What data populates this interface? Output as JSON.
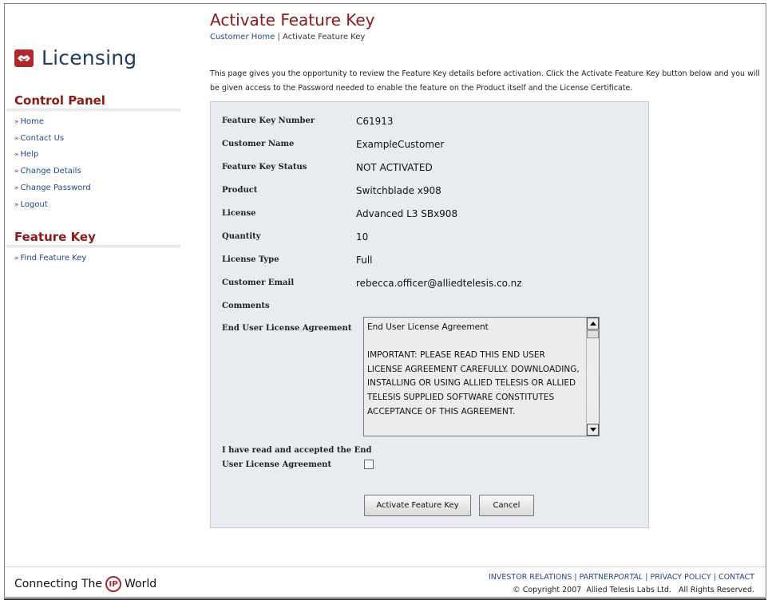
{
  "sidebar": {
    "app_title": "Licensing",
    "control_panel": {
      "title": "Control Panel",
      "items": [
        {
          "label": "Home"
        },
        {
          "label": "Contact Us"
        },
        {
          "label": "Help"
        },
        {
          "label": "Change Details"
        },
        {
          "label": "Change Password"
        },
        {
          "label": "Logout"
        }
      ]
    },
    "feature_key": {
      "title": "Feature Key",
      "items": [
        {
          "label": "Find Feature Key"
        }
      ]
    },
    "arrow": "»"
  },
  "header": {
    "title": "Activate Feature Key",
    "breadcrumb": {
      "home": "Customer Home",
      "separator": " | ",
      "current": "Activate Feature Key"
    }
  },
  "intro": "This page gives you the opportunity to review the Feature Key details before activation. Click the Activate Feature Key button below and you will be given access to the Password needed to enable the feature on the Product itself and the License Certificate.",
  "details": {
    "feature_key_number": {
      "label": "Feature Key Number",
      "value": "C61913"
    },
    "customer_name": {
      "label": "Customer Name",
      "value": "ExampleCustomer"
    },
    "status": {
      "label": "Feature Key Status",
      "value": "NOT ACTIVATED"
    },
    "product": {
      "label": "Product",
      "value": "Switchblade x908"
    },
    "license": {
      "label": "License",
      "value": "Advanced L3 SBx908"
    },
    "quantity": {
      "label": "Quantity",
      "value": "10"
    },
    "license_type": {
      "label": "License Type",
      "value": "Full"
    },
    "customer_email": {
      "label": "Customer Email",
      "value": "rebecca.officer@alliedtelesis.co.nz"
    },
    "comments": {
      "label": "Comments",
      "value": ""
    }
  },
  "eula": {
    "label": "End User License Agreement",
    "text": "End User License Agreement\n\nIMPORTANT: PLEASE READ THIS END USER LICENSE AGREEMENT CAREFULLY. DOWNLOADING, INSTALLING OR USING ALLIED TELESIS OR ALLIED TELESIS SUPPLIED SOFTWARE CONSTITUTES ACCEPTANCE OF THIS AGREEMENT."
  },
  "accept": {
    "label_line1": "I have read and accepted the End",
    "label_line2": "User License Agreement",
    "checked": false
  },
  "buttons": {
    "activate": "Activate Feature Key",
    "cancel": "Cancel"
  },
  "footer": {
    "tagline_prefix": "Connecting The",
    "tagline_badge": "IP",
    "tagline_suffix": "World",
    "links": {
      "investor": "INVESTOR RELATIONS",
      "partner_prefix": "PARTNER",
      "partner_suffix": "PORTAL",
      "privacy": "PRIVACY POLICY",
      "contact": "CONTACT",
      "separator": " | "
    },
    "copyright": "© Copyright 2007  Allied Telesis Labs Ltd.   All Rights Reserved."
  },
  "colors": {
    "brand_red": "#8b1a1a",
    "link_blue": "#1c4a8a",
    "panel_bg": "#e8ecf1"
  }
}
